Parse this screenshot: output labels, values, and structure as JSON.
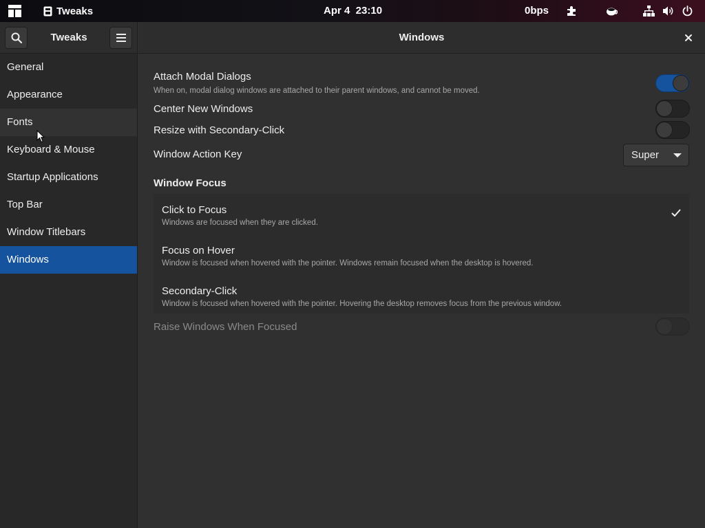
{
  "topbar": {
    "app_name": "Tweaks",
    "clock": "Apr 4  23:10",
    "net_speed": "0bps",
    "icons": [
      "activities-icon",
      "tweaks-app-icon",
      "extensions-puzzle-icon",
      "caffeine-cup-icon",
      "network-icon",
      "volume-icon",
      "power-icon"
    ]
  },
  "sidebar": {
    "title": "Tweaks",
    "items": [
      {
        "label": "General"
      },
      {
        "label": "Appearance"
      },
      {
        "label": "Fonts"
      },
      {
        "label": "Keyboard & Mouse"
      },
      {
        "label": "Startup Applications"
      },
      {
        "label": "Top Bar"
      },
      {
        "label": "Window Titlebars"
      },
      {
        "label": "Windows"
      }
    ],
    "active_item": "Windows",
    "hovered_item": "Fonts"
  },
  "main": {
    "title": "Windows",
    "attach_modal": {
      "label": "Attach Modal Dialogs",
      "description": "When on, modal dialog windows are attached to their parent windows, and cannot be moved.",
      "enabled": true
    },
    "center_new": {
      "label": "Center New Windows",
      "enabled": false
    },
    "resize_secondary": {
      "label": "Resize with Secondary-Click",
      "enabled": false
    },
    "action_key": {
      "label": "Window Action Key",
      "value": "Super"
    },
    "focus_section": {
      "title": "Window Focus",
      "options": [
        {
          "label": "Click to Focus",
          "description": "Windows are focused when they are clicked.",
          "selected": true
        },
        {
          "label": "Focus on Hover",
          "description": "Window is focused when hovered with the pointer. Windows remain focused when the desktop is hovered.",
          "selected": false
        },
        {
          "label": "Secondary-Click",
          "description": "Window is focused when hovered with the pointer. Hovering the desktop removes focus from the previous window.",
          "selected": false
        }
      ]
    },
    "raise_focused": {
      "label": "Raise Windows When Focused",
      "enabled": false,
      "sensitive": false
    }
  },
  "colors": {
    "accent": "#15539e",
    "window_bg": "#303030",
    "sidebar_bg": "#282828",
    "headerbar_bg": "#2d2d2d"
  }
}
